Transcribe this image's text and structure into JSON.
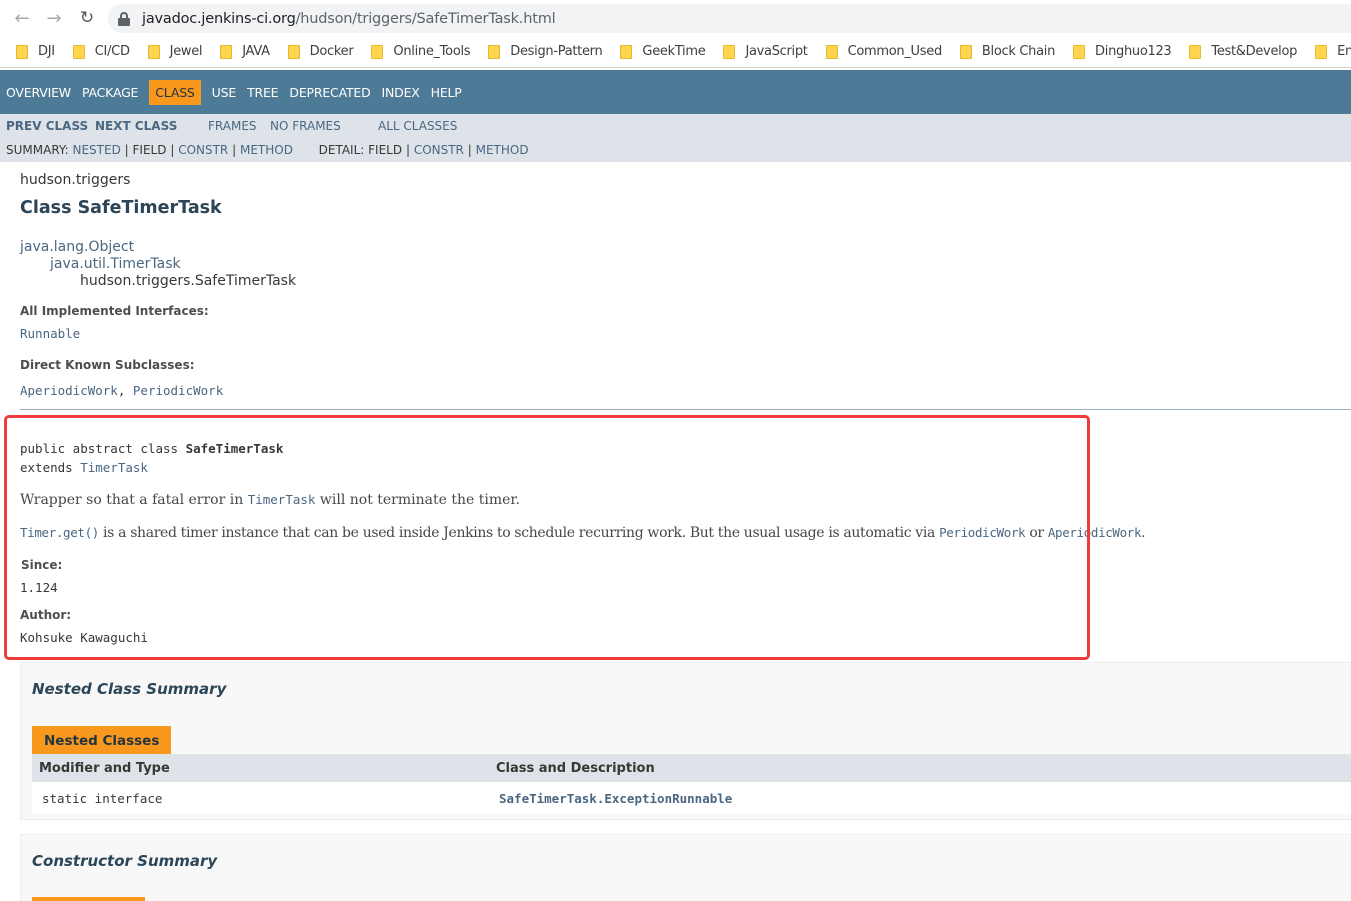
{
  "browser": {
    "url_host": "javadoc.jenkins-ci.org",
    "url_path": "/hudson/triggers/SafeTimerTask.html",
    "bookmarks": [
      "DJI",
      "CI/CD",
      "Jewel",
      "JAVA",
      "Docker",
      "Online_Tools",
      "Design-Pattern",
      "GeekTime",
      "JavaScript",
      "Common_Used",
      "Block Chain",
      "Dinghuo123",
      "Test&Develop",
      "English_V"
    ]
  },
  "topnav": {
    "items": [
      "OVERVIEW",
      "PACKAGE",
      "CLASS",
      "USE",
      "TREE",
      "DEPRECATED",
      "INDEX",
      "HELP"
    ],
    "active": "CLASS"
  },
  "subnav": {
    "prev_class": "PREV CLASS",
    "next_class": "NEXT CLASS",
    "frames": "FRAMES",
    "no_frames": "NO FRAMES",
    "all_classes": "ALL CLASSES",
    "summary_label": "SUMMARY:",
    "summary_links": [
      "NESTED",
      "FIELD",
      "CONSTR",
      "METHOD"
    ],
    "detail_label": "DETAIL:",
    "detail_links": [
      "FIELD",
      "CONSTR",
      "METHOD"
    ]
  },
  "header": {
    "package": "hudson.triggers",
    "title": "Class SafeTimerTask"
  },
  "inheritance": [
    "java.lang.Object",
    "java.util.TimerTask",
    "hudson.triggers.SafeTimerTask"
  ],
  "interfaces_label": "All Implemented Interfaces:",
  "interfaces": "Runnable",
  "subclasses_label": "Direct Known Subclasses:",
  "subclasses": [
    "AperiodicWork",
    "PeriodicWork"
  ],
  "declaration": {
    "modifiers": "public abstract class ",
    "name": "SafeTimerTask",
    "extends_kw": "extends ",
    "extends": "TimerTask"
  },
  "description": {
    "p1_a": "Wrapper so that a fatal error in ",
    "p1_link": "TimerTask",
    "p1_b": " will not terminate the timer.",
    "p2_link1": "Timer.get()",
    "p2_a": " is a shared timer instance that can be used inside Jenkins to schedule recurring work. But the usual usage is automatic via ",
    "p2_link2": "PeriodicWork",
    "p2_b": " or ",
    "p2_link3": "AperiodicWork",
    "p2_c": "."
  },
  "since_label": "Since:",
  "since": "1.124",
  "author_label": "Author:",
  "author": "Kohsuke Kawaguchi",
  "nested_summary": {
    "heading": "Nested Class Summary",
    "tab": "Nested Classes",
    "col1": "Modifier and Type",
    "col2": "Class and Description",
    "rows": [
      {
        "modifier": "static interface",
        "name": "SafeTimerTask.ExceptionRunnable"
      }
    ]
  },
  "constructor_summary": {
    "heading": "Constructor Summary"
  },
  "colors": {
    "nav_bg": "#4d7a97",
    "active_tab": "#f8981d",
    "subnav_bg": "#dee3e9",
    "highlight": "#ef3b3b",
    "link": "#4a6782"
  }
}
